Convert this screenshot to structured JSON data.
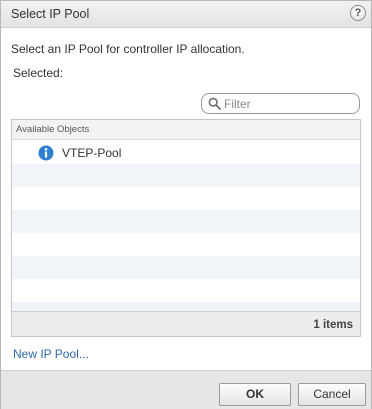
{
  "dialog": {
    "title": "Select IP Pool",
    "help_icon_glyph": "?",
    "instruction": "Select an IP Pool for controller IP allocation.",
    "selected_label": "Selected:"
  },
  "filter": {
    "placeholder": "Filter",
    "value": "",
    "icon": "search-icon"
  },
  "grid": {
    "column_header": "Available Objects",
    "rows": [
      {
        "label": "VTEP-Pool",
        "icon": "info-icon"
      }
    ],
    "empty_row_count": 7,
    "footer_count": "1 items"
  },
  "links": {
    "new_pool": "New IP Pool..."
  },
  "buttons": {
    "ok": "OK",
    "cancel": "Cancel"
  },
  "colors": {
    "link": "#2f6aa9",
    "info_icon": "#2f7fd1",
    "row_alt": "#f1f5fa"
  }
}
